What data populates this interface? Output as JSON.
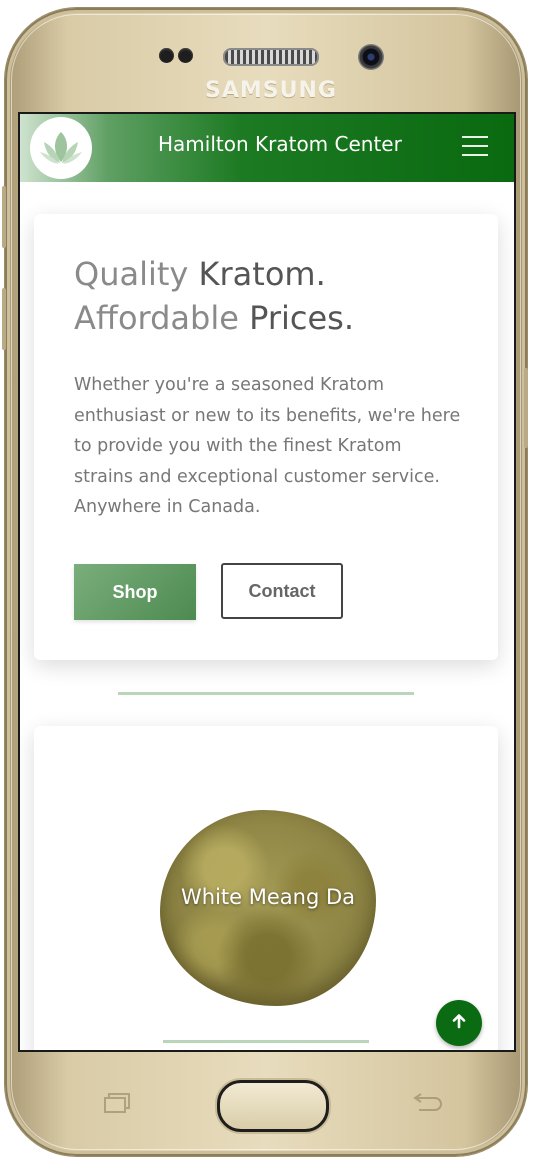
{
  "device": {
    "brand": "SAMSUNG"
  },
  "navbar": {
    "title": "Hamilton Kratom Center",
    "logo_icon": "leaf-icon",
    "menu_icon": "hamburger-menu-icon",
    "brand_color": "#0a6a10"
  },
  "hero": {
    "title_line1_muted": "Quality",
    "title_line1_rest": " Kratom.",
    "title_line2_muted": "Affordable",
    "title_line2_rest": " Prices.",
    "description": "Whether you're a seasoned Kratom enthusiast or new to its benefits, we're here to provide you with the finest Kratom strains and exceptional customer service. Anywhere in Canada.",
    "shop_label": "Shop",
    "contact_label": "Contact"
  },
  "product": {
    "name": "White Meang Da"
  },
  "scroll_top": {
    "icon": "arrow-up-icon"
  },
  "colors": {
    "accent": "#0b6b12",
    "divider": "#b9d6ba",
    "button": "#5e9a61"
  }
}
